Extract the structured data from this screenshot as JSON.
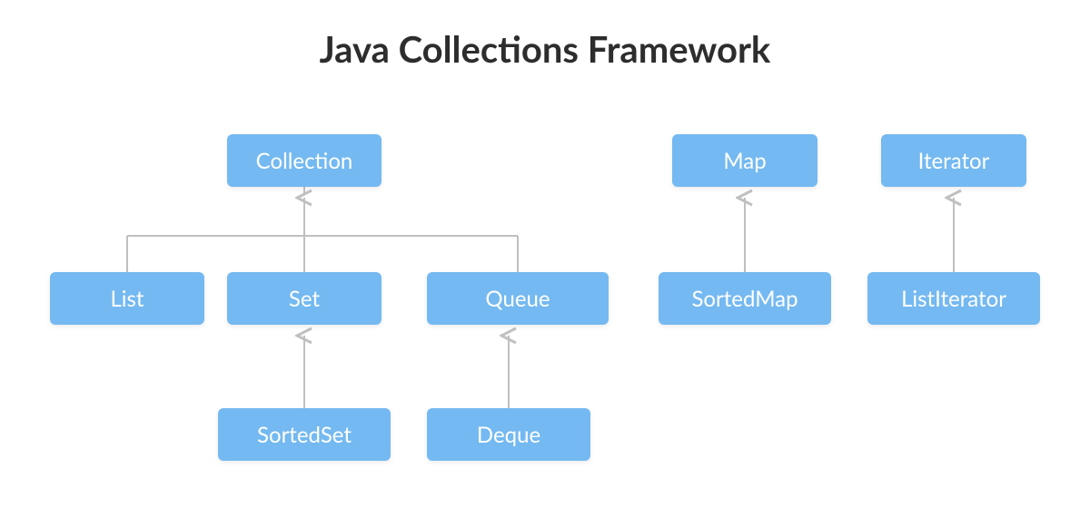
{
  "title": "Java Collections Framework",
  "nodes": {
    "collection": "Collection",
    "map": "Map",
    "iterator": "Iterator",
    "list": "List",
    "set": "Set",
    "queue": "Queue",
    "sortedmap": "SortedMap",
    "listiterator": "ListIterator",
    "sortedset": "SortedSet",
    "deque": "Deque"
  },
  "hierarchy": {
    "Collection": [
      "List",
      "Set",
      "Queue"
    ],
    "Set": [
      "SortedSet"
    ],
    "Queue": [
      "Deque"
    ],
    "Map": [
      "SortedMap"
    ],
    "Iterator": [
      "ListIterator"
    ]
  },
  "colors": {
    "node_bg": "#74b9f1",
    "node_text": "#ffffff",
    "connector": "#c0c0c0",
    "title": "#2d2d2d"
  }
}
